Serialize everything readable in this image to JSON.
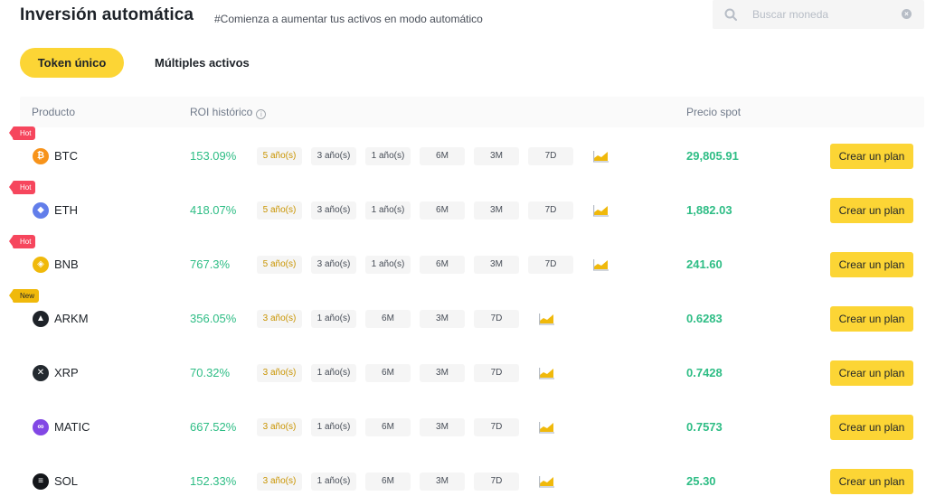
{
  "header": {
    "title": "Inversión automática",
    "subtitle": "#Comienza a aumentar tus activos en modo automático"
  },
  "search": {
    "placeholder": "Buscar moneda",
    "value": "",
    "icon": "search-icon"
  },
  "tabs": [
    {
      "label": "Token único",
      "active": true
    },
    {
      "label": "Múltiples activos",
      "active": false
    }
  ],
  "table": {
    "columns": {
      "product": "Producto",
      "roi": "ROI histórico",
      "price": "Precio spot"
    },
    "action_label": "Crear un plan",
    "rows": [
      {
        "symbol": "BTC",
        "badge": "Hot",
        "roi": "153.09%",
        "periods": [
          "5 año(s)",
          "3 año(s)",
          "1 año(s)",
          "6M",
          "3M",
          "7D"
        ],
        "selected_period": "5 año(s)",
        "price": "29,805.91",
        "icon_color": "#f7931a",
        "icon_glyph": "₿"
      },
      {
        "symbol": "ETH",
        "badge": "Hot",
        "roi": "418.07%",
        "periods": [
          "5 año(s)",
          "3 año(s)",
          "1 año(s)",
          "6M",
          "3M",
          "7D"
        ],
        "selected_period": "5 año(s)",
        "price": "1,882.03",
        "icon_color": "#627eea",
        "icon_glyph": "◆"
      },
      {
        "symbol": "BNB",
        "badge": "Hot",
        "roi": "767.3%",
        "periods": [
          "5 año(s)",
          "3 año(s)",
          "1 año(s)",
          "6M",
          "3M",
          "7D"
        ],
        "selected_period": "5 año(s)",
        "price": "241.60",
        "icon_color": "#f0b90b",
        "icon_glyph": "◈"
      },
      {
        "symbol": "ARKM",
        "badge": "New",
        "roi": "356.05%",
        "periods": [
          "3 año(s)",
          "1 año(s)",
          "6M",
          "3M",
          "7D"
        ],
        "selected_period": "3 año(s)",
        "price": "0.6283",
        "icon_color": "#1e2329",
        "icon_glyph": "▲"
      },
      {
        "symbol": "XRP",
        "badge": "",
        "roi": "70.32%",
        "periods": [
          "3 año(s)",
          "1 año(s)",
          "6M",
          "3M",
          "7D"
        ],
        "selected_period": "3 año(s)",
        "price": "0.7428",
        "icon_color": "#23292f",
        "icon_glyph": "✕"
      },
      {
        "symbol": "MATIC",
        "badge": "",
        "roi": "667.52%",
        "periods": [
          "3 año(s)",
          "1 año(s)",
          "6M",
          "3M",
          "7D"
        ],
        "selected_period": "3 año(s)",
        "price": "0.7573",
        "icon_color": "#8247e5",
        "icon_glyph": "∞"
      },
      {
        "symbol": "SOL",
        "badge": "",
        "roi": "152.33%",
        "periods": [
          "3 año(s)",
          "1 año(s)",
          "6M",
          "3M",
          "7D"
        ],
        "selected_period": "3 año(s)",
        "price": "25.30",
        "icon_color": "#14161a",
        "icon_glyph": "≡"
      }
    ]
  },
  "colors": {
    "accent": "#fcd535",
    "positive": "#2ebd85",
    "hot_badge": "#f6465d",
    "new_badge": "#f0b90b",
    "selected_period": "#c99400"
  }
}
